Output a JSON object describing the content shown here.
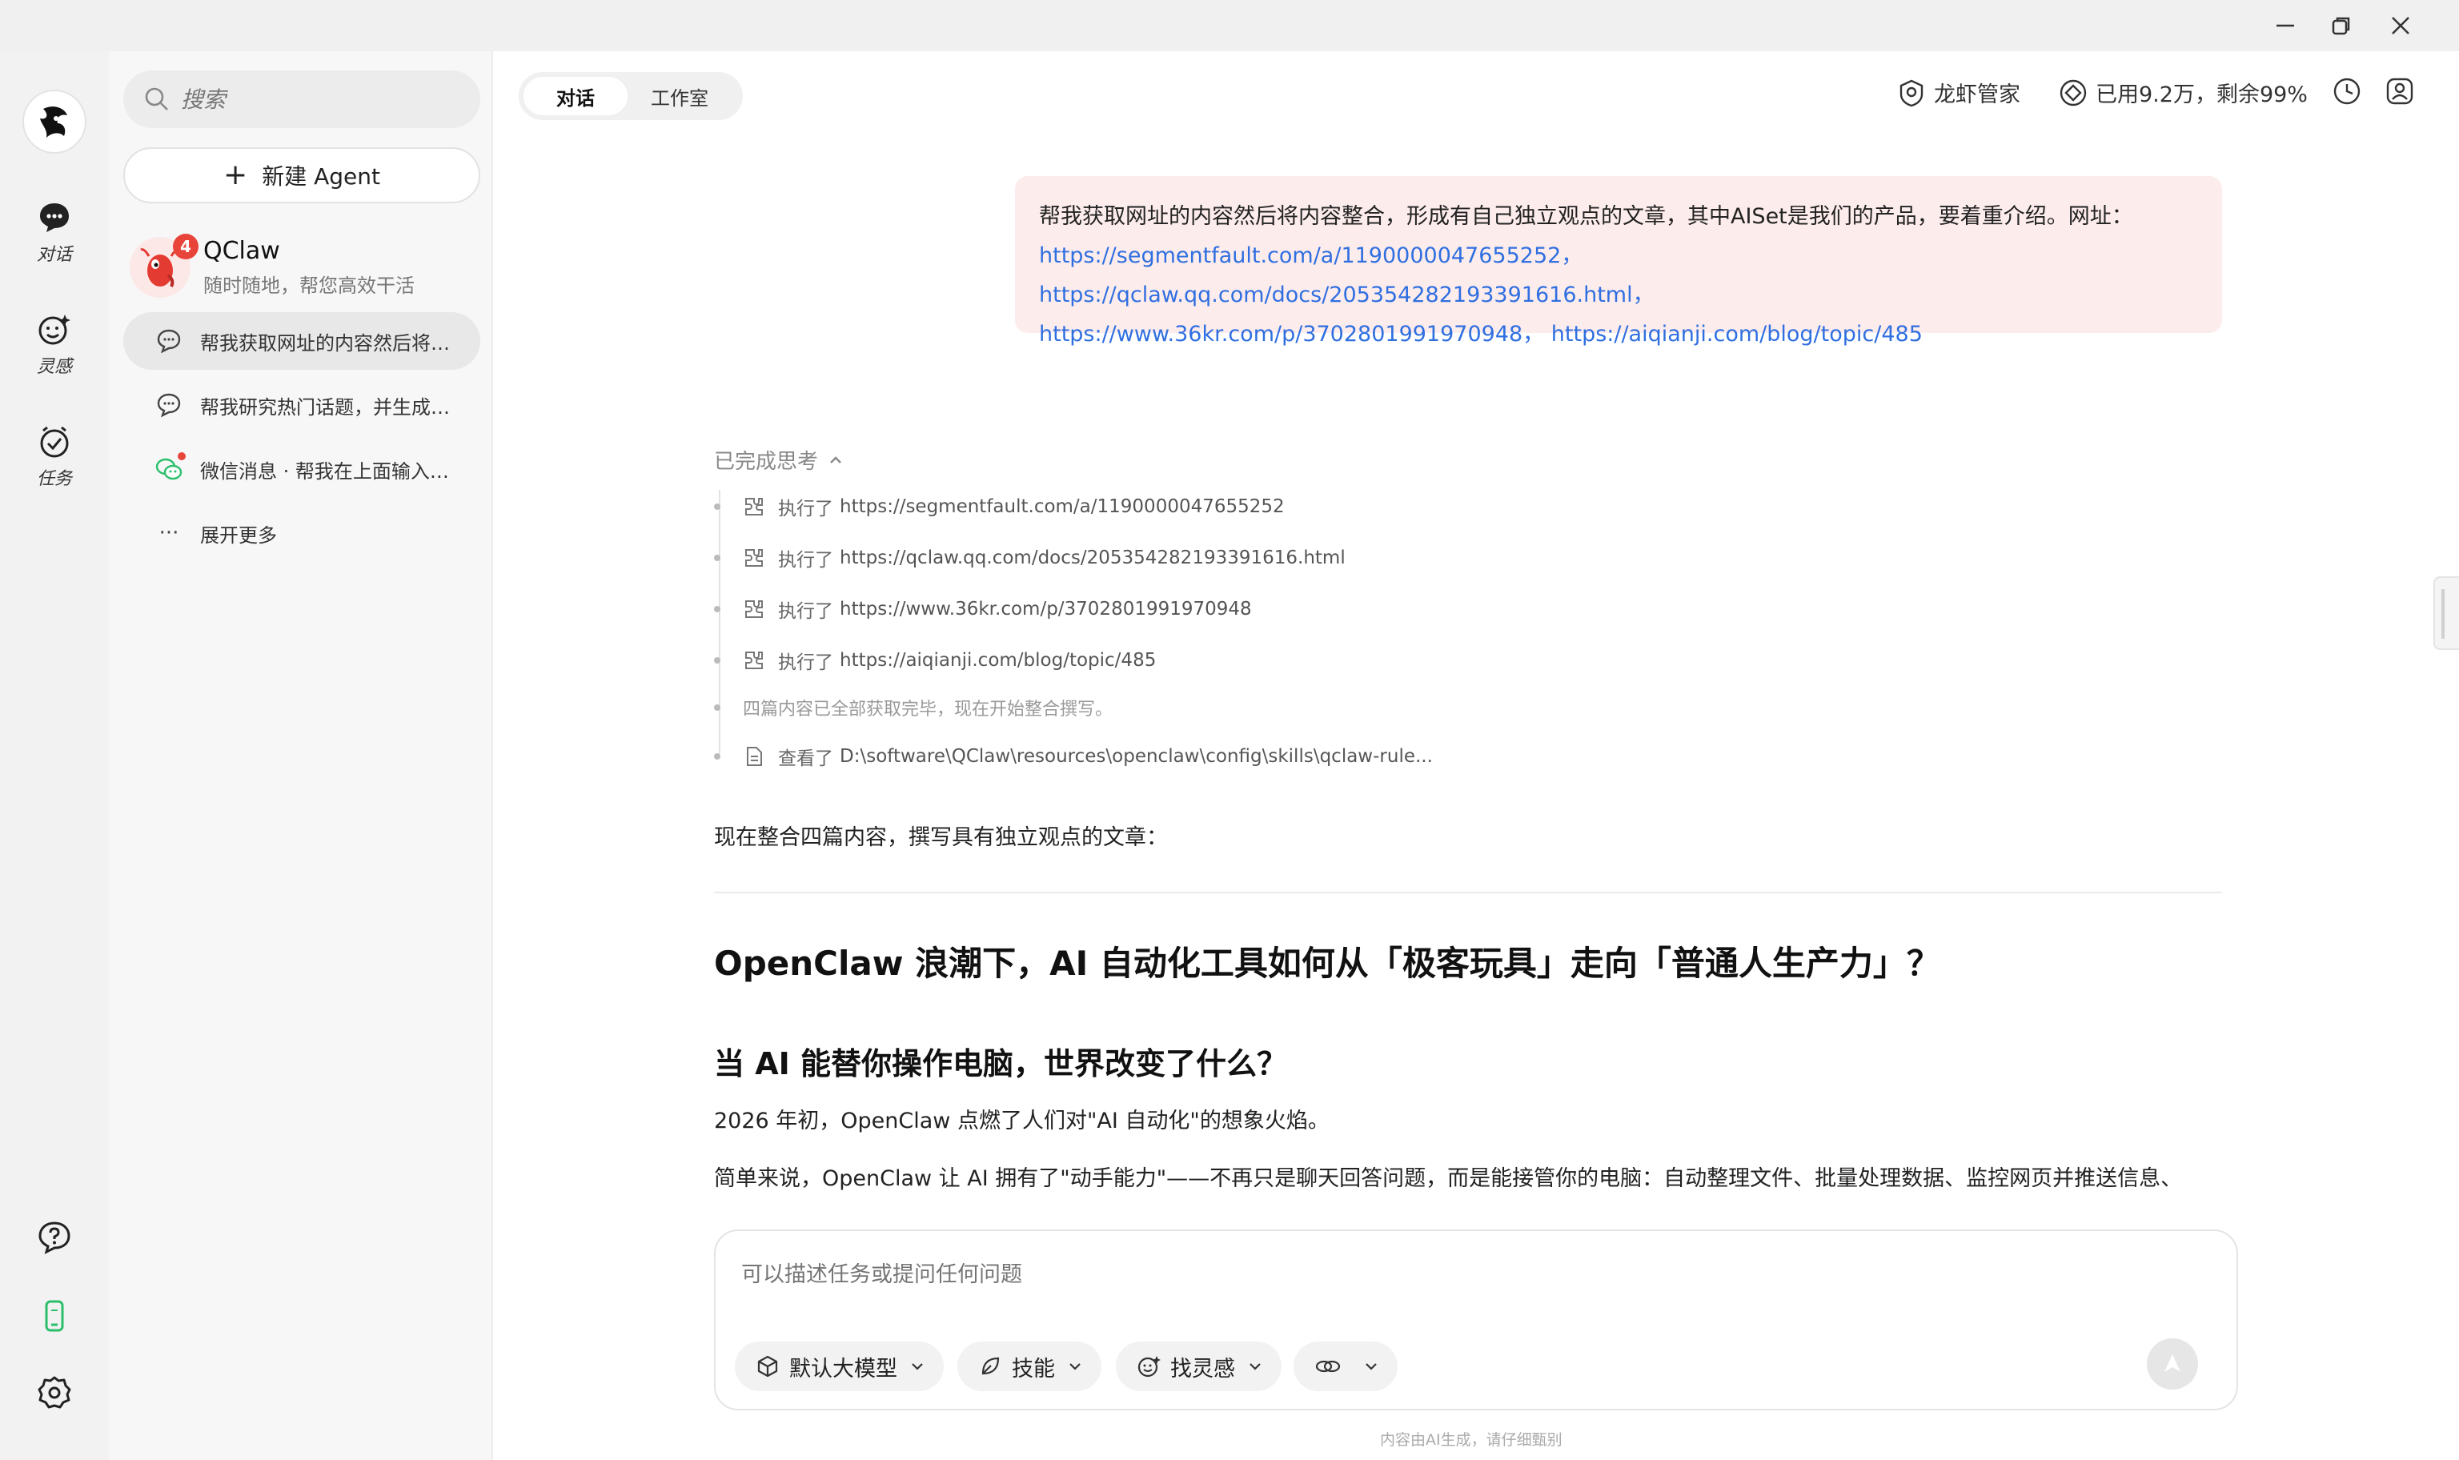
{
  "window": {
    "minimize": "—",
    "restore": "❐",
    "close": "✕"
  },
  "rail": {
    "items": [
      {
        "label": "对话",
        "icon": "chat-bubble-icon"
      },
      {
        "label": "灵感",
        "icon": "smile-sparkle-icon"
      },
      {
        "label": "任务",
        "icon": "check-clock-icon"
      }
    ],
    "bottom": [
      {
        "icon": "help-icon"
      },
      {
        "icon": "phone-icon",
        "color": "#2bbf6a"
      },
      {
        "icon": "settings-icon"
      }
    ]
  },
  "sidebar": {
    "search_placeholder": "搜索",
    "new_agent_label": "新建 Agent",
    "agent": {
      "name": "QClaw",
      "subtitle": "随时随地，帮您高效干活",
      "badge": "4"
    },
    "conversations": [
      {
        "text": "帮我获取网址的内容然后将内容整合",
        "icon": "chat-icon",
        "active": true
      },
      {
        "text": "帮我研究热门话题，并生成文章",
        "icon": "chat-icon"
      },
      {
        "text": "微信消息 · 帮我在上面输入内容",
        "icon": "wechat-icon"
      },
      {
        "text": "展开更多",
        "icon": "more-icon"
      }
    ]
  },
  "tabs": [
    {
      "label": "对话",
      "active": true
    },
    {
      "label": "工作室"
    }
  ],
  "header": {
    "manager_label": "龙虾管家",
    "usage_label": "已用9.2万，剩余99%"
  },
  "message": {
    "prefix": "帮我获取网址的内容然后将内容整合，形成有自己独立观点的文章，其中AISet是我们的产品，要着重介绍。网址：",
    "links": [
      "https://segmentfault.com/a/1190000047655252，",
      "https://qclaw.qq.com/docs/205354282193391616.html，",
      "https://www.36kr.com/p/3702801991970948，",
      "https://aiqianji.com/blog/topic/485"
    ]
  },
  "thinking": {
    "header": "已完成思考",
    "steps": [
      {
        "verb": "执行了",
        "target": "https://segmentfault.com/a/1190000047655252",
        "icon": "tool-icon"
      },
      {
        "verb": "执行了",
        "target": "https://qclaw.qq.com/docs/205354282193391616.html",
        "icon": "tool-icon"
      },
      {
        "verb": "执行了",
        "target": "https://www.36kr.com/p/3702801991970948",
        "icon": "tool-icon"
      },
      {
        "verb": "执行了",
        "target": "https://aiqianji.com/blog/topic/485",
        "icon": "tool-icon"
      },
      {
        "verb": "四篇内容已全部获取完毕，现在开始整合撰写。",
        "target": "",
        "icon": ""
      },
      {
        "verb": "查看了",
        "target": "D:\\software\\QClaw\\resources\\openclaw\\config\\skills\\qclaw-rule...",
        "icon": "file-icon"
      }
    ]
  },
  "answer": {
    "intro": "现在整合四篇内容，撰写具有独立观点的文章：",
    "title": "OpenClaw 浪潮下，AI 自动化工具如何从「极客玩具」走向「普通人生产力」？",
    "section_title": "当 AI 能替你操作电脑，世界改变了什么？",
    "p1": "2026 年初，OpenClaw 点燃了人们对\"AI 自动化\"的想象火焰。",
    "p2": "简单来说，OpenClaw 让 AI 拥有了\"动手能力\"——不再只是聊天回答问题，而是能接管你的电脑：自动整理文件、批量处理数据、监控网页并推送信息、"
  },
  "composer": {
    "placeholder": "可以描述任务或提问任何问题",
    "chips": [
      {
        "label": "默认大模型",
        "icon": "cube-icon"
      },
      {
        "label": "技能",
        "icon": "leaf-icon"
      },
      {
        "label": "找灵感",
        "icon": "smile-sparkle-icon"
      },
      {
        "label": "",
        "icon": "link-icon"
      }
    ],
    "footnote": "内容由AI生成，请仔细甄别"
  },
  "colors": {
    "accent_link": "#2f6fe0",
    "bubble_bg": "#fdecec",
    "badge": "#e8443a",
    "wechat": "#2bbf6a"
  }
}
